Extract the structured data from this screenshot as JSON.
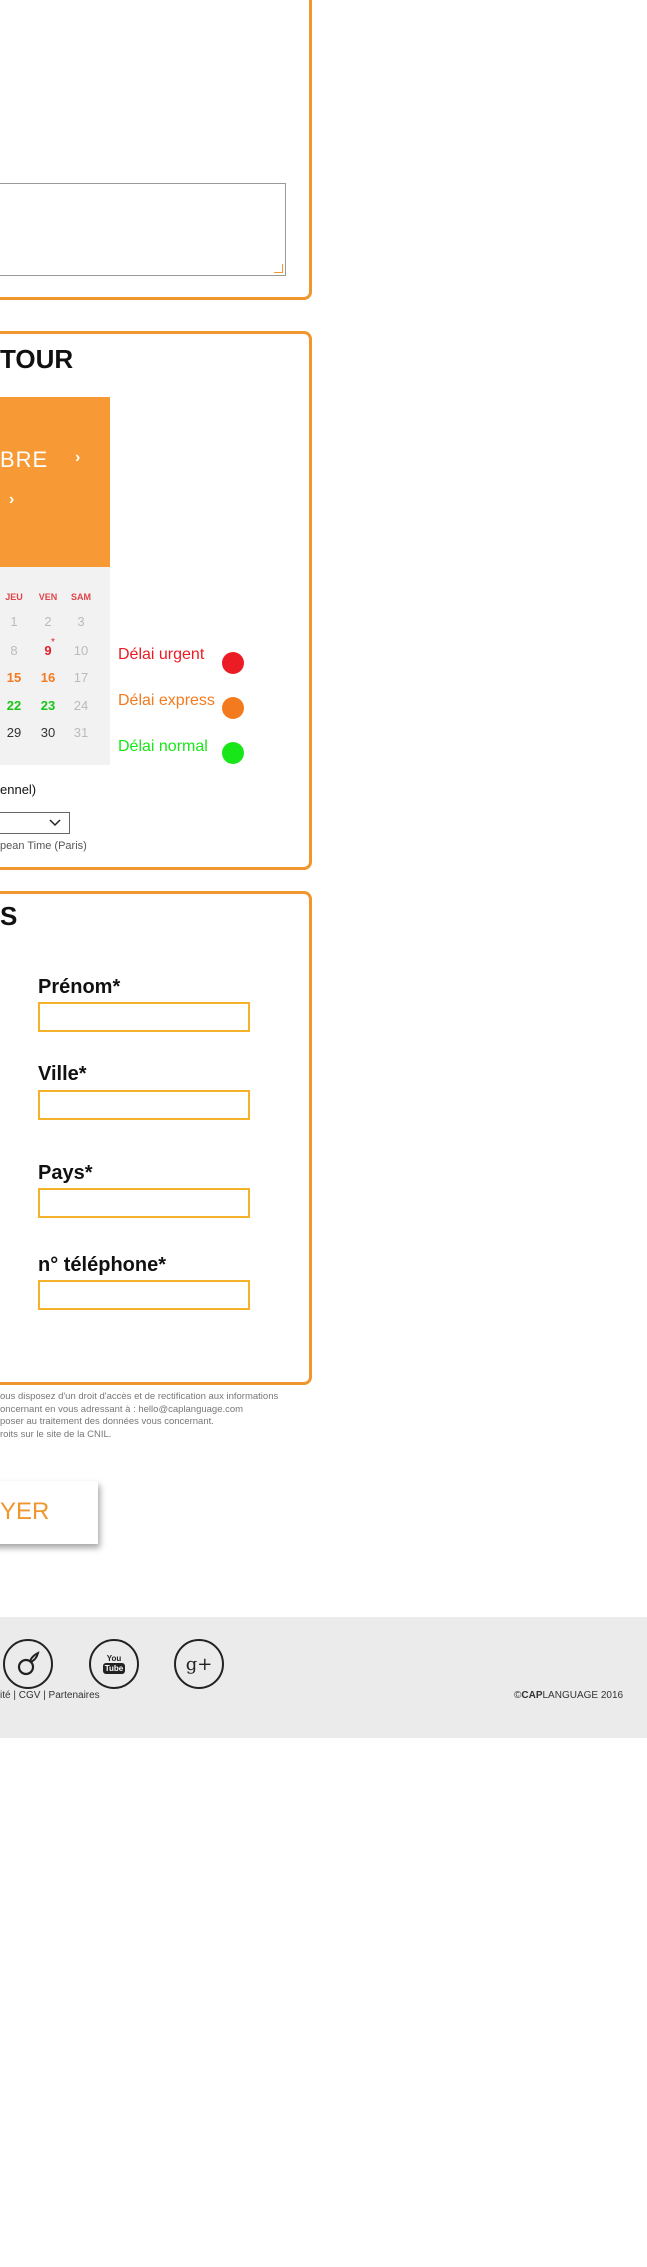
{
  "comment_panel": {},
  "date_panel": {
    "title": "TOUR",
    "calendar": {
      "month_label": "BRE",
      "weekday_headers": [
        "JEU",
        "VEN",
        "SAM"
      ],
      "rows": [
        [
          "1",
          "2",
          "3"
        ],
        [
          "8",
          "9",
          "10"
        ],
        [
          "15",
          "16",
          "17"
        ],
        [
          "22",
          "23",
          "24"
        ],
        [
          "29",
          "30",
          "31"
        ]
      ],
      "marker": "*"
    },
    "legend": [
      {
        "label": "Délai urgent",
        "color": "#ec1c24"
      },
      {
        "label": "Délai express",
        "color": "#f47a1f"
      },
      {
        "label": "Délai normal",
        "color": "#19e619"
      }
    ],
    "time_label": "ennel)",
    "timezone_note": "pean Time (Paris)"
  },
  "contact_panel": {
    "title": "S",
    "fields": [
      {
        "label": "Prénom*"
      },
      {
        "label": "Ville*"
      },
      {
        "label": "Pays*"
      },
      {
        "label": "n° téléphone*"
      }
    ]
  },
  "legal_lines": [
    "ous disposez d'un droit d'accès et de rectification aux informations",
    "oncernant en vous adressant à : hello@caplanguage.com",
    "poser au traitement des données vous concernant.",
    "roits sur le site de la CNIL."
  ],
  "submit": {
    "label": "YER"
  },
  "footer": {
    "social": [
      "viadeo-icon",
      "youtube-icon",
      "google-plus-icon"
    ],
    "youtube_text": [
      "You",
      "Tube"
    ],
    "gplus_text": "g+",
    "links": "ité | CGV | Partenaires",
    "copyright_prefix": "©",
    "copyright_brand": "CAP",
    "copyright_suffix": "LANGUAGE 2016"
  },
  "colors": {
    "accent": "#f0962e",
    "calendar_header": "#f79a36",
    "input_border": "#f4b22b",
    "urgent": "#ec1c24",
    "express": "#f47a1f",
    "normal": "#19e619"
  }
}
